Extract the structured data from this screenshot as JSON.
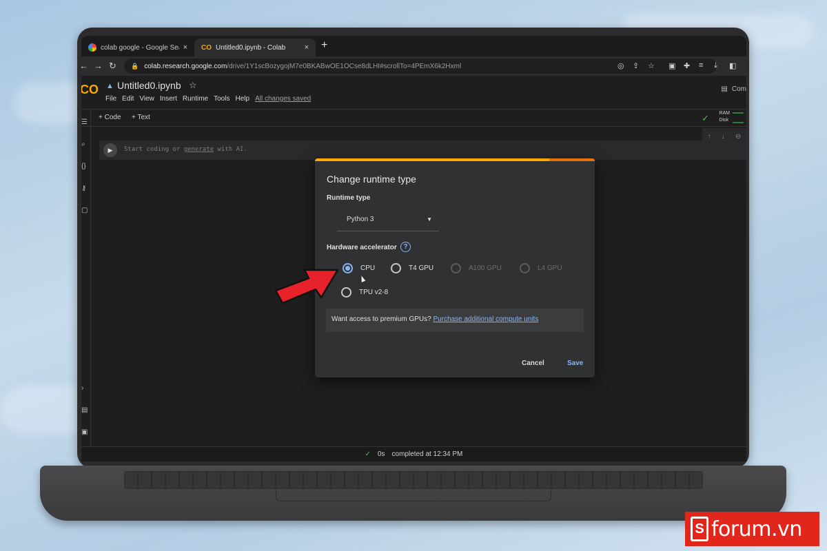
{
  "browser": {
    "tabs": [
      {
        "title": "colab google - Google Search",
        "close": "×"
      },
      {
        "title": "Untitled0.ipynb - Colab",
        "close": "×"
      }
    ],
    "new_tab": "+",
    "url_host": "colab.research.google.com",
    "url_path": "/drive/1Y1scBozygojM7e0BKABwOE1OCse8dLHI#scrollTo=4PEmX6k2Hxml"
  },
  "colab": {
    "logo": "CO",
    "notebook_title": "Untitled0.ipynb",
    "menu": [
      "File",
      "Edit",
      "View",
      "Insert",
      "Runtime",
      "Tools",
      "Help"
    ],
    "saved_status": "All changes saved",
    "comment_label": "Com",
    "add_code": "+ Code",
    "add_text": "+ Text",
    "ram_label": "RAM",
    "disk_label": "Disk",
    "cell_placeholder_prefix": "Start coding or ",
    "cell_placeholder_link": "generate",
    "cell_placeholder_suffix": " with AI.",
    "status_duration": "0s",
    "status_completed": "completed at 12:34 PM"
  },
  "dialog": {
    "title": "Change runtime type",
    "runtime_label": "Runtime type",
    "runtime_value": "Python 3",
    "accelerator_label": "Hardware accelerator",
    "options": [
      {
        "label": "CPU",
        "state": "selected"
      },
      {
        "label": "T4 GPU",
        "state": "enabled"
      },
      {
        "label": "A100 GPU",
        "state": "disabled"
      },
      {
        "label": "L4 GPU",
        "state": "disabled"
      },
      {
        "label": "TPU v2-8",
        "state": "enabled"
      }
    ],
    "premium_text": "Want access to premium GPUs? ",
    "premium_link": "Purchase additional compute units",
    "cancel": "Cancel",
    "save": "Save"
  },
  "brand": {
    "mark": "S",
    "text": "forum.vn"
  },
  "colors": {
    "accent": "#f9ab00",
    "link": "#8ab4f8",
    "brand_red": "#e1261c",
    "annotation_red": "#e8222a"
  }
}
